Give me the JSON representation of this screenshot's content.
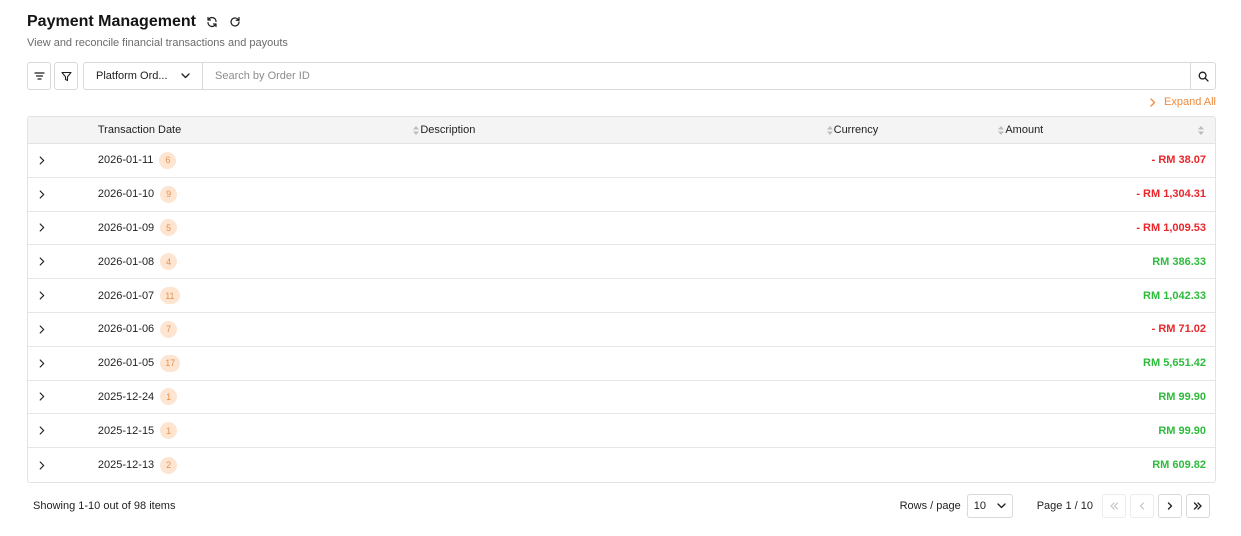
{
  "header": {
    "title": "Payment Management",
    "subtitle": "View and reconcile financial transactions and payouts",
    "icons": [
      "sync-icon",
      "refresh-icon"
    ]
  },
  "toolbar": {
    "filter_type_label": "Platform Ord...",
    "search_placeholder": "Search by Order ID",
    "search_value": "",
    "icons": [
      "list-filter-icon",
      "funnel-icon",
      "chevron-down-icon",
      "search-icon"
    ]
  },
  "expand_all_label": "Expand All",
  "table": {
    "columns": [
      "Transaction Date",
      "Description",
      "Currency",
      "Amount"
    ],
    "rows": [
      {
        "date": "2026-01-11",
        "count": "6",
        "description": "",
        "currency": "",
        "amount": "- RM 38.07",
        "sign": "neg"
      },
      {
        "date": "2026-01-10",
        "count": "9",
        "description": "",
        "currency": "",
        "amount": "- RM 1,304.31",
        "sign": "neg"
      },
      {
        "date": "2026-01-09",
        "count": "5",
        "description": "",
        "currency": "",
        "amount": "- RM 1,009.53",
        "sign": "neg"
      },
      {
        "date": "2026-01-08",
        "count": "4",
        "description": "",
        "currency": "",
        "amount": "RM 386.33",
        "sign": "pos"
      },
      {
        "date": "2026-01-07",
        "count": "11",
        "description": "",
        "currency": "",
        "amount": "RM 1,042.33",
        "sign": "pos"
      },
      {
        "date": "2026-01-06",
        "count": "7",
        "description": "",
        "currency": "",
        "amount": "- RM 71.02",
        "sign": "neg"
      },
      {
        "date": "2026-01-05",
        "count": "17",
        "description": "",
        "currency": "",
        "amount": "RM 5,651.42",
        "sign": "pos"
      },
      {
        "date": "2025-12-24",
        "count": "1",
        "description": "",
        "currency": "",
        "amount": "RM 99.90",
        "sign": "pos"
      },
      {
        "date": "2025-12-15",
        "count": "1",
        "description": "",
        "currency": "",
        "amount": "RM 99.90",
        "sign": "pos"
      },
      {
        "date": "2025-12-13",
        "count": "2",
        "description": "",
        "currency": "",
        "amount": "RM 609.82",
        "sign": "pos"
      }
    ]
  },
  "footer": {
    "showing_text": "Showing 1-10 out of 98 items",
    "rows_per_page_label": "Rows / page",
    "rows_per_page_value": "10",
    "page_text": "Page 1 / 10"
  },
  "colors": {
    "accent": "#f08a3c",
    "badge_bg": "#fde5d2",
    "badge_text": "#e8914a",
    "negative": "#e8262b",
    "positive": "#2ebb3c"
  }
}
